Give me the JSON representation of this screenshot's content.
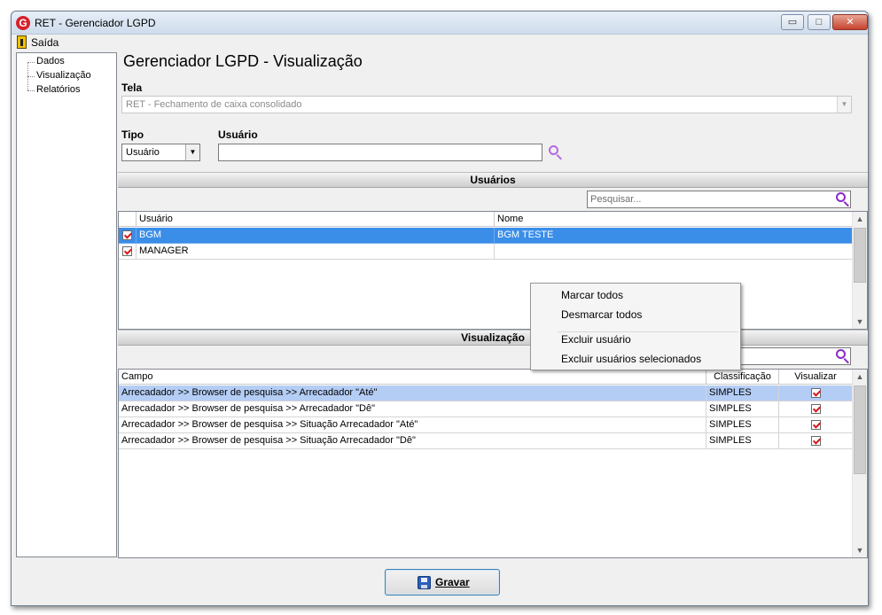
{
  "window": {
    "title": "RET - Gerenciador LGPD",
    "app_icon_letter": "G",
    "buttons": {
      "minimize": "▭",
      "maximize": "□",
      "close": "✕"
    }
  },
  "menu": {
    "exit_label": "Saída"
  },
  "tree": {
    "items": [
      "Dados",
      "Visualização",
      "Relatórios"
    ]
  },
  "page": {
    "title": "Gerenciador LGPD - Visualização",
    "tela_label": "Tela",
    "tela_value": "RET - Fechamento de caixa consolidado",
    "tipo_label": "Tipo",
    "tipo_value": "Usuário",
    "usuario_label": "Usuário",
    "usuario_value": ""
  },
  "users_section": {
    "title": "Usuários",
    "search_placeholder": "Pesquisar...",
    "columns": [
      "Usuário",
      "Nome"
    ],
    "rows": [
      {
        "checked": true,
        "usuario": "BGM",
        "nome": "BGM TESTE",
        "selected": true
      },
      {
        "checked": true,
        "usuario": "MANAGER",
        "nome": "",
        "selected": false
      }
    ]
  },
  "visualization_section": {
    "title": "Visualização",
    "columns": [
      "Campo",
      "Classificação",
      "Visualizar"
    ],
    "rows": [
      {
        "campo": "Arrecadador >> Browser de pesquisa >> Arrecadador \"Até\"",
        "classificacao": "SIMPLES",
        "visualizar": true,
        "selected": true
      },
      {
        "campo": "Arrecadador >> Browser de pesquisa >> Arrecadador \"Dê\"",
        "classificacao": "SIMPLES",
        "visualizar": true,
        "selected": false
      },
      {
        "campo": "Arrecadador >> Browser de pesquisa >> Situação Arrecadador \"Até\"",
        "classificacao": "SIMPLES",
        "visualizar": true,
        "selected": false
      },
      {
        "campo": "Arrecadador >> Browser de pesquisa >> Situação Arrecadador \"Dê\"",
        "classificacao": "SIMPLES",
        "visualizar": true,
        "selected": false
      }
    ]
  },
  "context_menu": {
    "items": [
      "Marcar todos",
      "Desmarcar todos",
      "Excluir usuário",
      "Excluir usuários selecionados"
    ]
  },
  "footer": {
    "save_label": "Gravar"
  },
  "colors": {
    "selection": "#3a8ee8",
    "selection_light": "#b4cdf5",
    "search_icon": "#8a2ac9",
    "check": "#d31b1b"
  },
  "icons": {
    "search": "magnifier-icon",
    "save": "floppy-icon",
    "exit": "exit-door-icon"
  }
}
